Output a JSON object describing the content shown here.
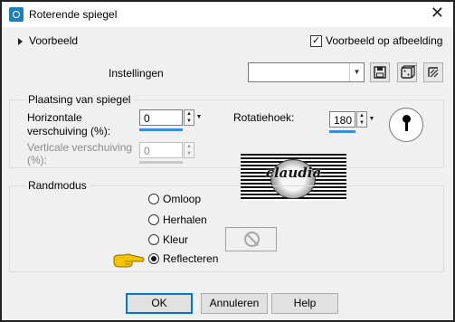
{
  "window": {
    "title": "Roterende spiegel",
    "close_glyph": "✕"
  },
  "preview_row": {
    "toggle_label": "Voorbeeld",
    "checkbox_label": "Voorbeeld op afbeelding",
    "checkbox_checked": true
  },
  "settings": {
    "label": "Instellingen",
    "combo_value": "",
    "icons": [
      "save-icon",
      "dice-icon",
      "reset-icon"
    ]
  },
  "placement": {
    "group_label": "Plaatsing van spiegel",
    "horizontal_label_line1": "Horizontale",
    "horizontal_label_line2": "verschuiving (%):",
    "horizontal_value": "0",
    "vertical_label_line1": "Verticale verschuiving",
    "vertical_label_line2": "(%):",
    "vertical_value": "0",
    "rotation_label": "Rotatiehoek:",
    "rotation_value": "180"
  },
  "preview_image": {
    "watermark": "claudia"
  },
  "mode": {
    "group_label": "Randmodus",
    "options": [
      "Omloop",
      "Herhalen",
      "Kleur",
      "Reflecteren"
    ],
    "selected": "Reflecteren"
  },
  "buttons": {
    "ok": "OK",
    "cancel": "Annuleren",
    "help": "Help"
  }
}
